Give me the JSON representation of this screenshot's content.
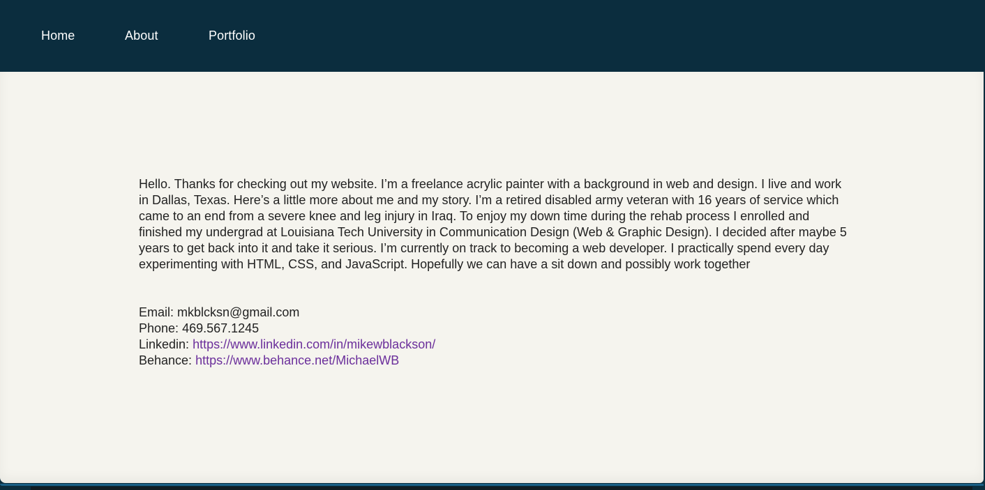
{
  "nav": {
    "items": [
      {
        "label": "Home"
      },
      {
        "label": "About"
      },
      {
        "label": "Portfolio"
      }
    ]
  },
  "about": {
    "bio": "Hello. Thanks for checking out my website. I’m a freelance acrylic painter with a background in web and design. I live and work in Dallas, Texas. Here’s a little more about me and my story. I’m a retired disabled army veteran with 16 years of service which came to an end from a severe knee and leg injury in Iraq. To enjoy my down time during the rehab process I enrolled and finished my undergrad at Louisiana Tech University in Communication Design (Web & Graphic Design). I decided after maybe 5 years to get back into it and take it serious. I’m currently on track to becoming a web developer. I practically spend every day experimenting with HTML, CSS, and JavaScript. Hopefully we can have a sit down and possibly work together"
  },
  "contact": {
    "email_label": "Email:",
    "email_value": "mkblcksn@gmail.com",
    "phone_label": "Phone:",
    "phone_value": "469.567.1245",
    "linkedin_label": "Linkedin:",
    "linkedin_url": "https://www.linkedin.com/in/mikewblackson/",
    "behance_label": "Behance:",
    "behance_url": "https://www.behance.net/MichaelWB"
  },
  "colors": {
    "nav_background": "#0b2d3e",
    "content_background": "#f5f4ee",
    "link": "#6b2f9b",
    "text": "#222222"
  }
}
